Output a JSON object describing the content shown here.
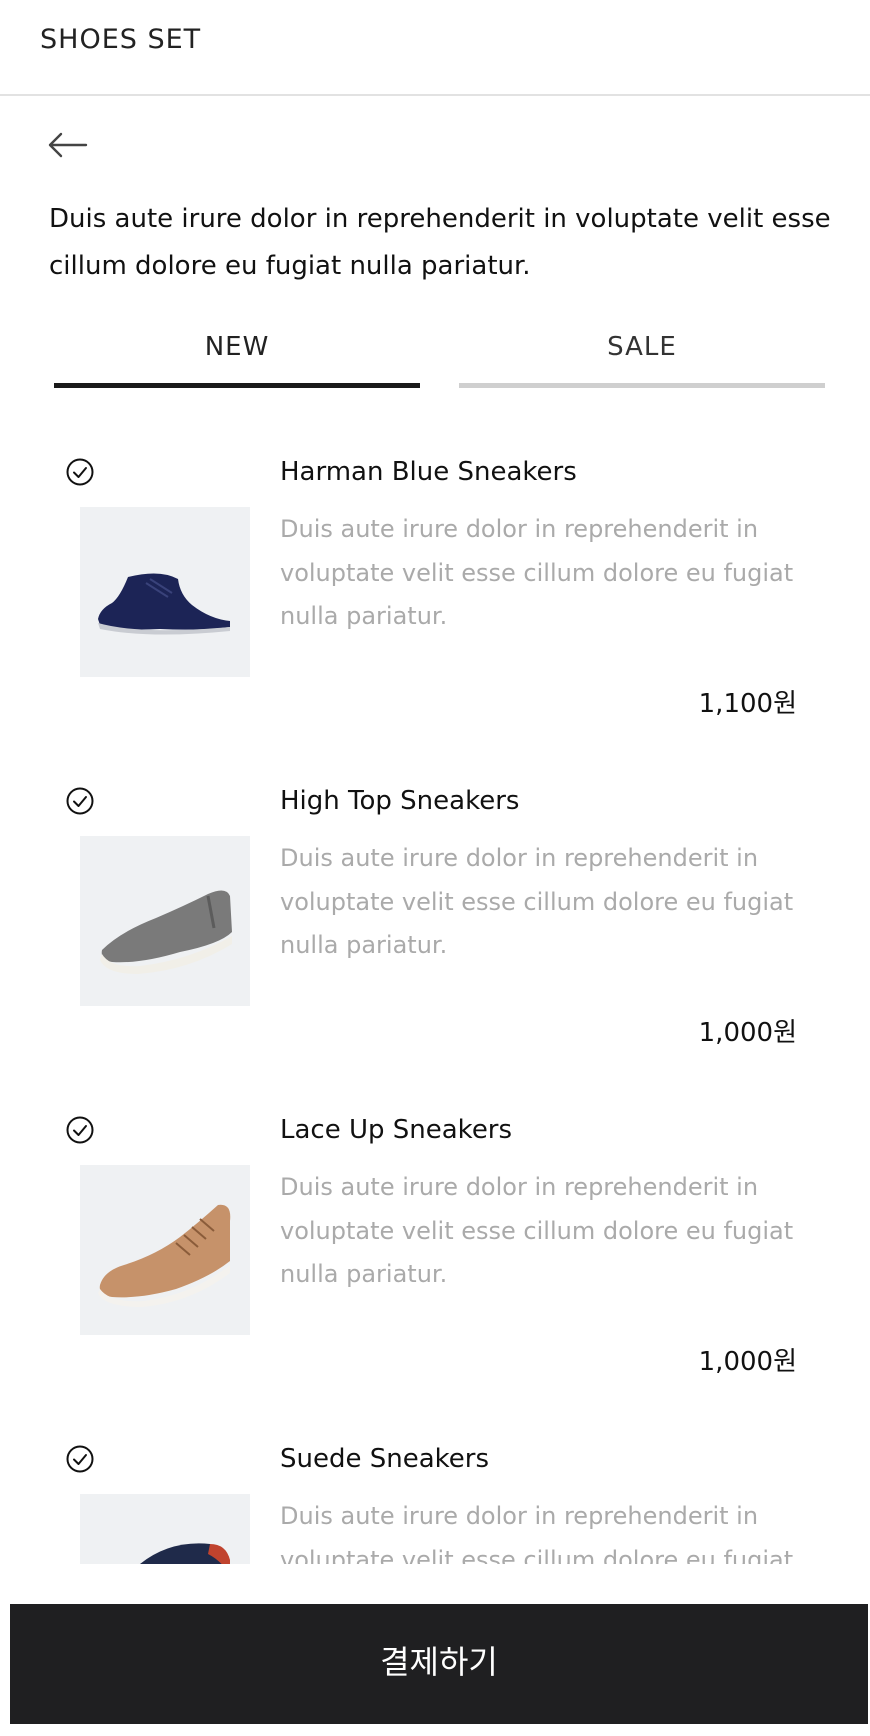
{
  "header": {
    "title": "SHOES SET"
  },
  "nav": {
    "back_icon": "arrow-left-icon"
  },
  "intro": {
    "text": "Duis aute irure dolor in reprehenderit in voluptate velit esse cillum dolore eu fugiat nulla pariatur."
  },
  "tabs": [
    {
      "label": "NEW",
      "active": true
    },
    {
      "label": "SALE",
      "active": false
    }
  ],
  "products": [
    {
      "name": "Harman Blue Sneakers",
      "description": "Duis aute irure dolor in reprehenderit in voluptate velit esse cillum dolore eu fugiat nulla pariatur.",
      "price": "1,100원",
      "image": "navy-chukka-shoe",
      "checked": true
    },
    {
      "name": "High Top Sneakers",
      "description": "Duis aute irure dolor in reprehenderit in voluptate velit esse cillum dolore eu fugiat nulla pariatur.",
      "price": "1,000원",
      "image": "grey-chelsea-shoe",
      "checked": true
    },
    {
      "name": "Lace Up Sneakers",
      "description": "Duis aute irure dolor in reprehenderit in voluptate velit esse cillum dolore eu fugiat nulla pariatur.",
      "price": "1,000원",
      "image": "tan-lace-up-shoe",
      "checked": true
    },
    {
      "name": "Suede Sneakers",
      "description": "Duis aute irure dolor in reprehenderit in voluptate velit esse cillum dolore eu fugiat nulla pariatur.",
      "price": "",
      "image": "suede-shoe",
      "checked": true
    }
  ],
  "footer": {
    "pay_label": "결제하기"
  },
  "colors": {
    "accent": "#1f1f21",
    "muted_text": "#aaaaaa",
    "thumb_bg": "#eff1f3"
  }
}
